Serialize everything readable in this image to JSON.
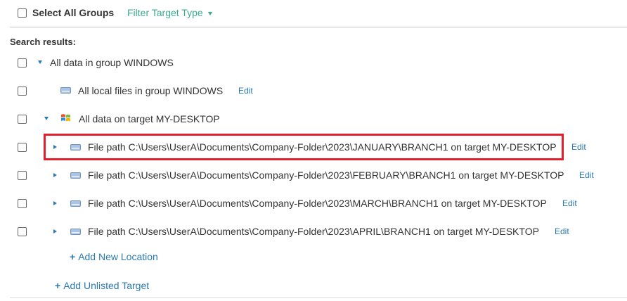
{
  "header": {
    "select_all_label": "Select All Groups",
    "filter_label": "Filter Target Type"
  },
  "search_results_label": "Search results:",
  "tree": {
    "group_row": {
      "label": "All data in group WINDOWS"
    },
    "local_files_row": {
      "label": "All local files in group WINDOWS",
      "edit": "Edit"
    },
    "target_row": {
      "label": "All data on target MY-DESKTOP"
    },
    "path_rows": [
      {
        "label": "File path C:\\Users\\UserA\\Documents\\Company-Folder\\2023\\JANUARY\\BRANCH1 on target MY-DESKTOP",
        "edit": "Edit",
        "highlighted": true
      },
      {
        "label": "File path C:\\Users\\UserA\\Documents\\Company-Folder\\2023\\FEBRUARY\\BRANCH1 on target MY-DESKTOP",
        "edit": "Edit"
      },
      {
        "label": "File path C:\\Users\\UserA\\Documents\\Company-Folder\\2023\\MARCH\\BRANCH1 on target MY-DESKTOP",
        "edit": "Edit"
      },
      {
        "label": "File path C:\\Users\\UserA\\Documents\\Company-Folder\\2023\\APRIL\\BRANCH1 on target MY-DESKTOP",
        "edit": "Edit"
      }
    ]
  },
  "actions": {
    "add_location": "Add New Location",
    "add_target": "Add Unlisted Target"
  },
  "colors": {
    "link": "#2a7ab0",
    "filter": "#3aaa8e",
    "highlight": "#e1202b",
    "text": "#333333"
  },
  "icons": {
    "drive": "drive-icon",
    "windows": "windows-logo-icon",
    "caret": "caret-icon",
    "plus": "plus-icon"
  }
}
